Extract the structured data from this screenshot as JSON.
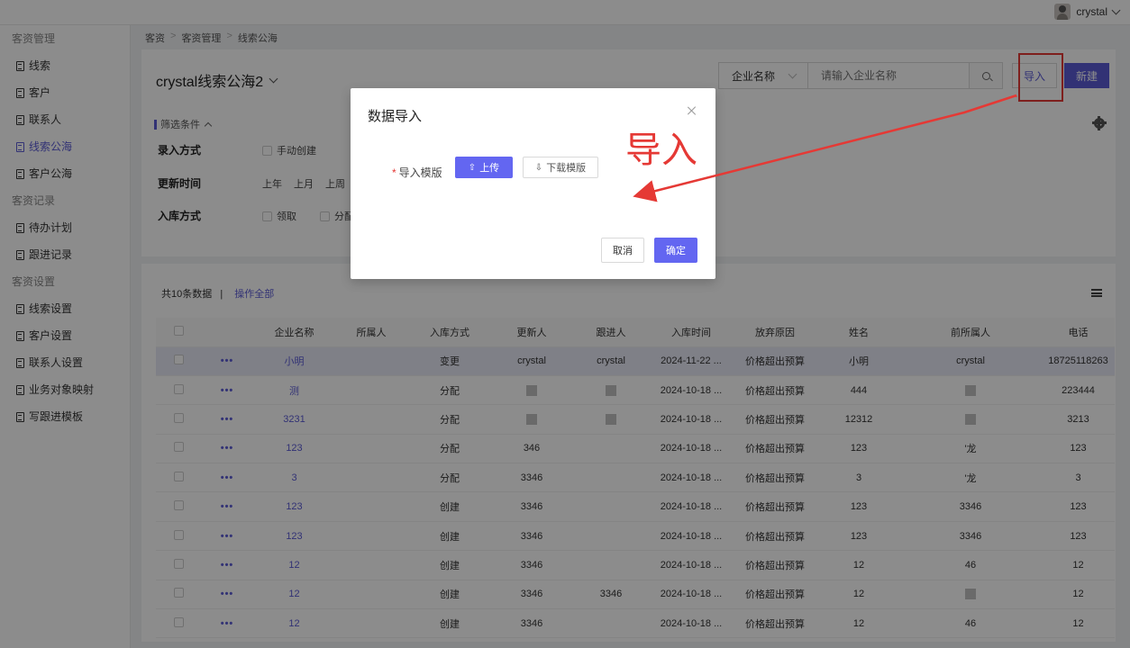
{
  "topbar": {
    "username": "crystal"
  },
  "sidebar": {
    "groups": [
      {
        "title": "客资管理",
        "items": [
          "线索",
          "客户",
          "联系人",
          "线索公海",
          "客户公海"
        ]
      },
      {
        "title": "客资记录",
        "items": [
          "待办计划",
          "跟进记录"
        ]
      },
      {
        "title": "客资设置",
        "items": [
          "线索设置",
          "客户设置",
          "联系人设置",
          "业务对象映射",
          "写跟进模板"
        ]
      }
    ],
    "active_item": "线索公海"
  },
  "breadcrumb": [
    "客资",
    "客资管理",
    "线索公海"
  ],
  "header": {
    "title": "crystal线索公海2",
    "search_field": "企业名称",
    "search_placeholder": "请输入企业名称",
    "import_label": "导入",
    "new_label": "新建"
  },
  "filters": {
    "title": "筛选条件",
    "rows": [
      {
        "label": "录入方式",
        "options": [
          "手动创建"
        ]
      },
      {
        "label": "更新时间",
        "options": [
          "上年",
          "上月",
          "上周"
        ]
      },
      {
        "label": "入库方式",
        "options": [
          "领取",
          "分配"
        ]
      }
    ]
  },
  "table": {
    "count_text": "共10条数据",
    "divider": "|",
    "select_all": "操作全部",
    "more_glyph": "•••",
    "columns": [
      "企业名称",
      "所属人",
      "入库方式",
      "更新人",
      "跟进人",
      "入库时间",
      "放弃原因",
      "姓名",
      "前所属人",
      "电话"
    ],
    "rows": [
      [
        "小明",
        "",
        "变更",
        "crystal",
        "crystal",
        "2024-11-22 ...",
        "价格超出预算",
        "小明",
        "crystal",
        "18725118263"
      ],
      [
        "测",
        "",
        "分配",
        "",
        "",
        "2024-10-18 ...",
        "价格超出预算",
        "444",
        "",
        "223444"
      ],
      [
        "3231",
        "",
        "分配",
        "",
        "",
        "2024-10-18 ...",
        "价格超出预算",
        "12312",
        "",
        "3213"
      ],
      [
        "123",
        "",
        "分配",
        "346",
        "",
        "2024-10-18 ...",
        "价格超出预算",
        "123",
        "'龙",
        "123"
      ],
      [
        "3",
        "",
        "分配",
        "3346",
        "",
        "2024-10-18 ...",
        "价格超出预算",
        "3",
        "'龙",
        "3"
      ],
      [
        "123",
        "",
        "创建",
        "3346",
        "",
        "2024-10-18 ...",
        "价格超出预算",
        "123",
        "3346",
        "123"
      ],
      [
        "123",
        "",
        "创建",
        "3346",
        "",
        "2024-10-18 ...",
        "价格超出预算",
        "123",
        "3346",
        "123"
      ],
      [
        "12",
        "",
        "创建",
        "3346",
        "",
        "2024-10-18 ...",
        "价格超出预算",
        "12",
        "46",
        "12"
      ],
      [
        "12",
        "",
        "创建",
        "3346",
        "3346",
        "2024-10-18 ...",
        "价格超出预算",
        "12",
        "",
        "12"
      ],
      [
        "12",
        "",
        "创建",
        "3346",
        "",
        "2024-10-18 ...",
        "价格超出预算",
        "12",
        "46",
        "12"
      ]
    ]
  },
  "modal": {
    "title": "数据导入",
    "field_label": "导入模版",
    "upload_label": "上传",
    "download_label": "下载模版",
    "cancel_label": "取消",
    "ok_label": "确定"
  },
  "annotation": {
    "text": "导入",
    "color": "#e53935"
  },
  "colors": {
    "accent": "#5b5bd6",
    "primary": "#6366f1",
    "annotation": "#e53935"
  }
}
